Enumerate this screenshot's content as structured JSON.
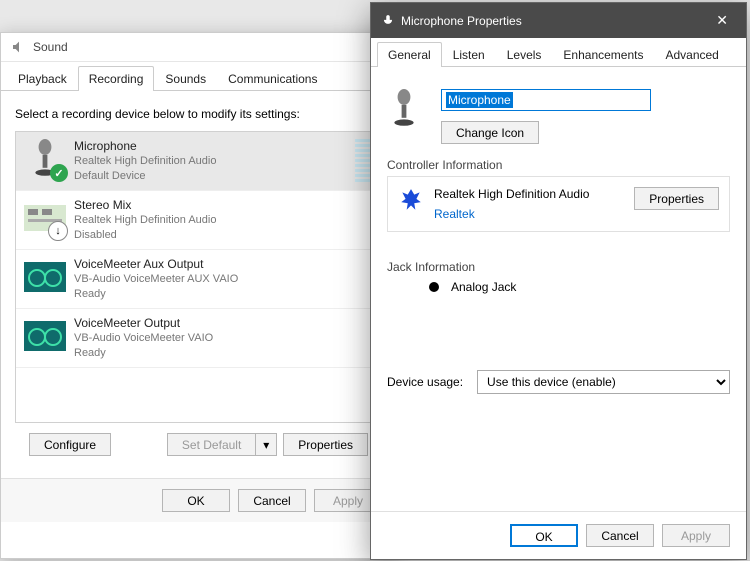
{
  "sound": {
    "title": "Sound",
    "tabs": [
      "Playback",
      "Recording",
      "Sounds",
      "Communications"
    ],
    "activeTab": 1,
    "instruction": "Select a recording device below to modify its settings:",
    "devices": [
      {
        "name": "Microphone",
        "sub": "Realtek High Definition Audio",
        "status": "Default Device",
        "selected": true,
        "icon": "mic",
        "badge": "ok",
        "levels": true
      },
      {
        "name": "Stereo Mix",
        "sub": "Realtek High Definition Audio",
        "status": "Disabled",
        "icon": "board",
        "badge": "down"
      },
      {
        "name": "VoiceMeeter Aux Output",
        "sub": "VB-Audio VoiceMeeter AUX VAIO",
        "status": "Ready",
        "icon": "vm"
      },
      {
        "name": "VoiceMeeter Output",
        "sub": "VB-Audio VoiceMeeter VAIO",
        "status": "Ready",
        "icon": "vm"
      }
    ],
    "configure": "Configure",
    "setDefault": "Set Default",
    "properties": "Properties",
    "ok": "OK",
    "cancel": "Cancel",
    "apply": "Apply"
  },
  "back": {
    "ok": "OK",
    "cancel": "Cancel",
    "apply": "Apply"
  },
  "prop": {
    "title": "Microphone Properties",
    "tabs": [
      "General",
      "Listen",
      "Levels",
      "Enhancements",
      "Advanced"
    ],
    "activeTab": 0,
    "name": "Microphone",
    "changeIcon": "Change Icon",
    "controllerLabel": "Controller Information",
    "controllerName": "Realtek High Definition Audio",
    "controllerVendor": "Realtek",
    "propertiesBtn": "Properties",
    "jackLabel": "Jack Information",
    "jackType": "Analog Jack",
    "usageLabel": "Device usage:",
    "usageValue": "Use this device (enable)",
    "ok": "OK",
    "cancel": "Cancel",
    "apply": "Apply"
  }
}
